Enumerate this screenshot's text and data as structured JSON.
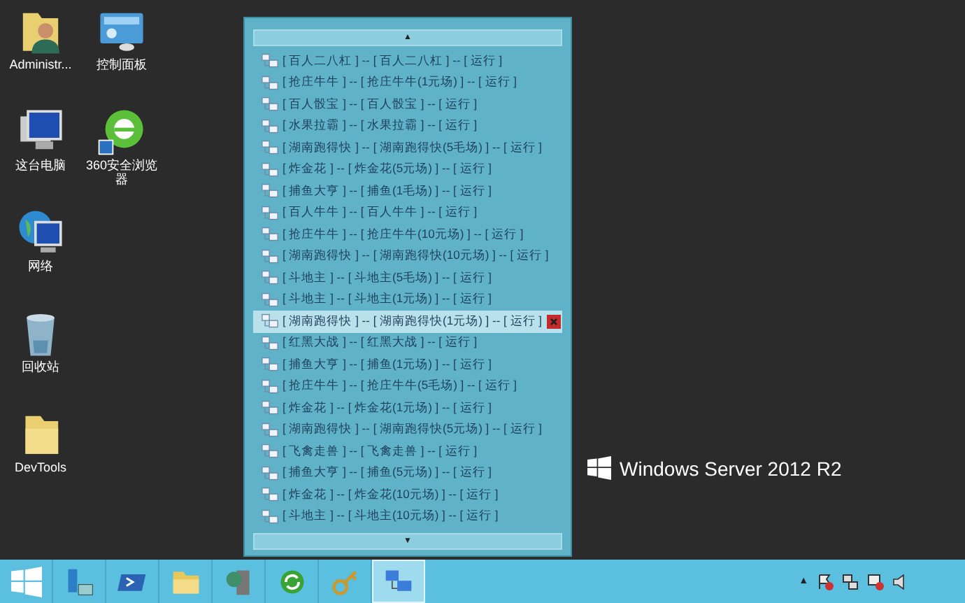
{
  "desktop_icons": [
    {
      "label": "Administr...",
      "kind": "user-folder"
    },
    {
      "label": "控制面板",
      "kind": "control-panel"
    },
    {
      "label": "这台电脑",
      "kind": "computer"
    },
    {
      "label": "360安全浏览器",
      "kind": "browser"
    },
    {
      "label": "网络",
      "kind": "network"
    },
    {
      "label": "回收站",
      "kind": "recycle-bin"
    },
    {
      "label": "DevTools",
      "kind": "folder"
    }
  ],
  "list_panel": {
    "scroll_up": "▲",
    "scroll_down": "▼",
    "rows": [
      {
        "text": "[ 百人二八杠 ] -- [ 百人二八杠 ] -- [ 运行 ]",
        "selected": false
      },
      {
        "text": "[ 抢庄牛牛 ] -- [ 抢庄牛牛(1元场) ] -- [ 运行 ]",
        "selected": false
      },
      {
        "text": "[ 百人骰宝 ] -- [ 百人骰宝 ] -- [ 运行 ]",
        "selected": false
      },
      {
        "text": "[ 水果拉霸 ] -- [ 水果拉霸 ] -- [ 运行 ]",
        "selected": false
      },
      {
        "text": "[ 湖南跑得快 ] -- [ 湖南跑得快(5毛场) ] -- [ 运行 ]",
        "selected": false
      },
      {
        "text": "[ 炸金花 ] -- [ 炸金花(5元场) ] -- [ 运行 ]",
        "selected": false
      },
      {
        "text": "[ 捕鱼大亨 ] -- [ 捕鱼(1毛场) ] -- [ 运行 ]",
        "selected": false
      },
      {
        "text": "[ 百人牛牛 ] -- [ 百人牛牛 ] -- [ 运行 ]",
        "selected": false
      },
      {
        "text": "[ 抢庄牛牛 ] -- [ 抢庄牛牛(10元场) ] -- [ 运行 ]",
        "selected": false
      },
      {
        "text": "[ 湖南跑得快 ] -- [ 湖南跑得快(10元场) ] -- [ 运行 ]",
        "selected": false
      },
      {
        "text": "[ 斗地主 ] -- [ 斗地主(5毛场) ] -- [ 运行 ]",
        "selected": false
      },
      {
        "text": "[ 斗地主 ] -- [ 斗地主(1元场) ] -- [ 运行 ]",
        "selected": false
      },
      {
        "text": "[ 湖南跑得快 ] -- [ 湖南跑得快(1元场) ] -- [ 运行 ]",
        "selected": true
      },
      {
        "text": "[ 红黑大战 ] -- [ 红黑大战 ] -- [ 运行 ]",
        "selected": false
      },
      {
        "text": "[ 捕鱼大亨 ] -- [ 捕鱼(1元场) ] -- [ 运行 ]",
        "selected": false
      },
      {
        "text": "[ 抢庄牛牛 ] -- [ 抢庄牛牛(5毛场) ] -- [ 运行 ]",
        "selected": false
      },
      {
        "text": "[ 炸金花 ] -- [ 炸金花(1元场) ] -- [ 运行 ]",
        "selected": false
      },
      {
        "text": "[ 湖南跑得快 ] -- [ 湖南跑得快(5元场) ] -- [ 运行 ]",
        "selected": false
      },
      {
        "text": "[ 飞禽走兽 ] -- [ 飞禽走兽 ] -- [ 运行 ]",
        "selected": false
      },
      {
        "text": "[ 捕鱼大亨 ] -- [ 捕鱼(5元场) ] -- [ 运行 ]",
        "selected": false
      },
      {
        "text": "[ 炸金花 ] -- [ 炸金花(10元场) ] -- [ 运行 ]",
        "selected": false
      },
      {
        "text": "[ 斗地主 ] -- [ 斗地主(10元场) ] -- [ 运行 ]",
        "selected": false
      }
    ]
  },
  "branding": {
    "text": "Windows Server 2012 R2"
  },
  "taskbar": {
    "items": [
      {
        "kind": "server-manager",
        "selected": false
      },
      {
        "kind": "powershell",
        "selected": false
      },
      {
        "kind": "explorer",
        "selected": false
      },
      {
        "kind": "server-tool",
        "selected": false
      },
      {
        "kind": "sync",
        "selected": false
      },
      {
        "kind": "keys",
        "selected": false
      },
      {
        "kind": "network-app",
        "selected": true
      }
    ],
    "tray_expand": "▲"
  }
}
